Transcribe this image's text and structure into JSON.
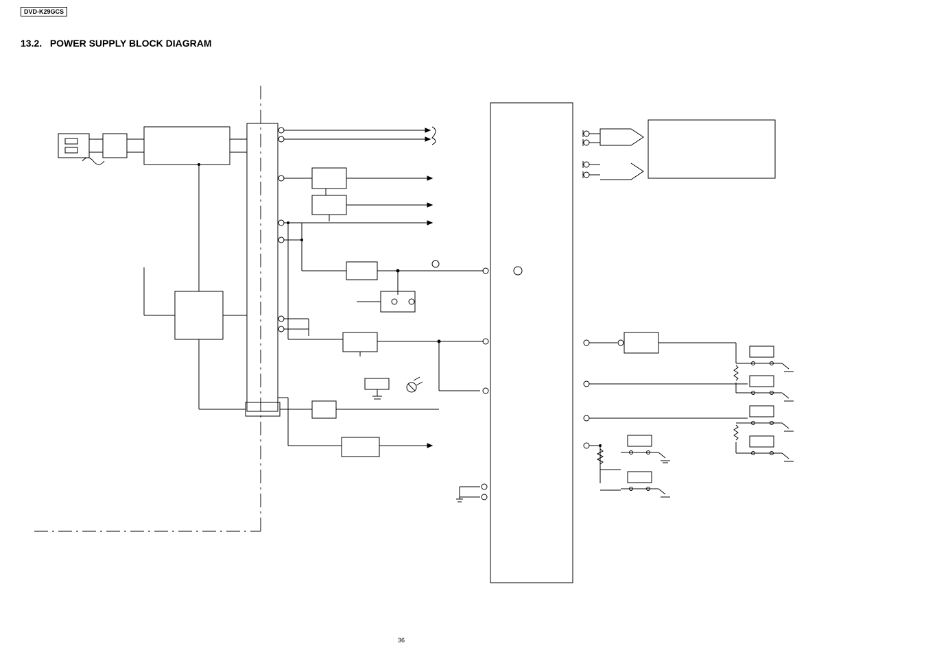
{
  "page": {
    "model": "DVD-K29GCS",
    "section_number": "13.2.",
    "section_title": "POWER SUPPLY BLOCK DIAGRAM",
    "page_number": "36"
  }
}
